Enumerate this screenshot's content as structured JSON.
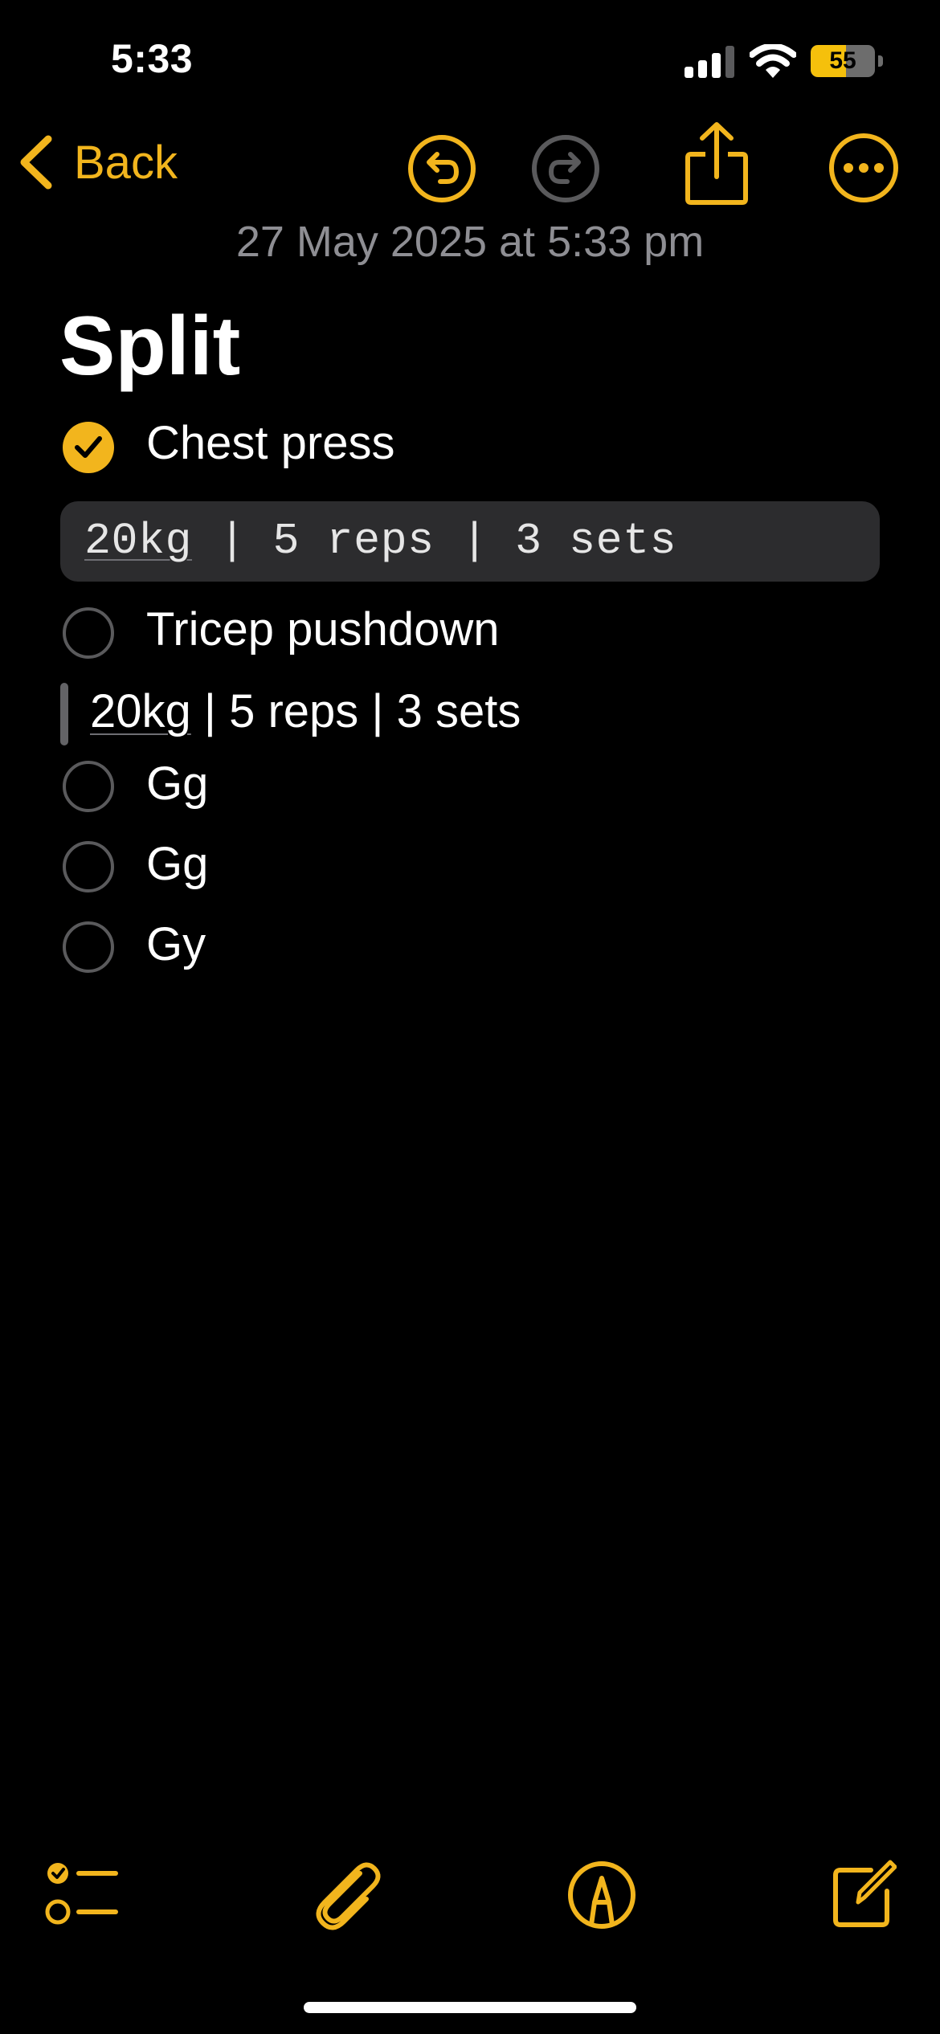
{
  "status_bar": {
    "time": "5:33",
    "battery_level": "55",
    "battery_percent": 55,
    "icons": [
      "signal-icon",
      "wifi-icon",
      "battery-icon"
    ]
  },
  "toolbar": {
    "back_label": "Back",
    "icons": [
      "chevron-left-icon",
      "undo-icon",
      "redo-icon",
      "share-icon",
      "more-icon"
    ]
  },
  "note": {
    "date": "27 May 2025 at 5:33 pm",
    "title": "Split",
    "items": [
      {
        "label": "Chest press",
        "checked": true
      },
      {
        "label": "Tricep pushdown",
        "checked": false
      },
      {
        "label": "Gg",
        "checked": false
      },
      {
        "label": "Gg",
        "checked": false
      },
      {
        "label": "Gy",
        "checked": false
      }
    ],
    "code_block": {
      "kg": "20kg",
      "rest": " | 5 reps | 3 sets"
    },
    "quote": {
      "kg": "20kg",
      "rest": " | 5 reps | 3 sets"
    }
  },
  "bottom_toolbar": {
    "icons": [
      "checklist-icon",
      "paperclip-icon",
      "markup-pen-icon",
      "compose-icon"
    ]
  },
  "colors": {
    "accent": "#f2b51d",
    "background": "#000000",
    "secondary_text": "#8e8e93",
    "code_bg": "#2c2c2e",
    "disabled": "#5a5a5c"
  }
}
